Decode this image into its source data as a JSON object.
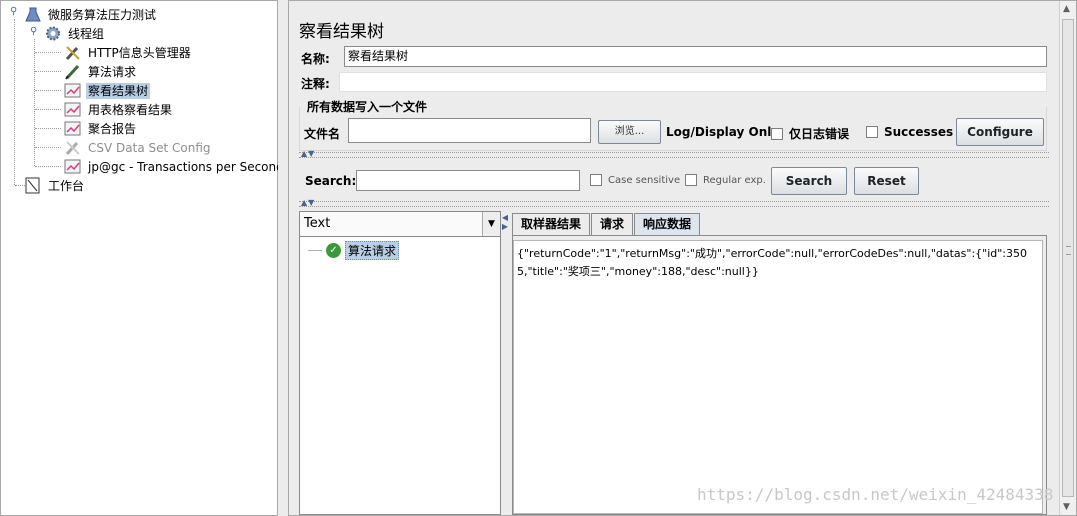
{
  "tree": {
    "items": [
      {
        "label": "微服务算法压力测试",
        "icon": "test-plan-icon"
      },
      {
        "label": "线程组",
        "icon": "thread-group-gear-icon"
      },
      {
        "label": "HTTP信息头管理器",
        "icon": "wrench-icon"
      },
      {
        "label": "算法请求",
        "icon": "http-sampler-pen-icon"
      },
      {
        "label": "察看结果树",
        "icon": "listener-chart-icon",
        "selected": true
      },
      {
        "label": "用表格察看结果",
        "icon": "listener-chart-icon"
      },
      {
        "label": "聚合报告",
        "icon": "listener-chart-icon"
      },
      {
        "label": "CSV Data Set Config",
        "icon": "config-wrench-icon",
        "disabled": true
      },
      {
        "label": "jp@gc - Transactions per Second",
        "icon": "listener-chart-icon"
      },
      {
        "label": "工作台",
        "icon": "workbench-icon"
      }
    ]
  },
  "panel": {
    "title": "察看结果树",
    "name_label": "名称:",
    "name_value": "察看结果树",
    "comment_label": "注释:",
    "comment_value": "",
    "file_group_title": "所有数据写入一个文件",
    "filename_label": "文件名",
    "filename_value": "",
    "browse_button": "浏览...",
    "log_display_label": "Log/Display Only:",
    "errors_only_label": "仅日志错误",
    "successes_label": "Successes",
    "configure_button": "Configure"
  },
  "search": {
    "label": "Search:",
    "value": "",
    "case_sensitive": "Case sensitive",
    "regular_exp": "Regular exp.",
    "search_button": "Search",
    "reset_button": "Reset"
  },
  "results": {
    "renderer": "Text",
    "samples": [
      {
        "label": "算法请求",
        "status": "success"
      }
    ],
    "tabs": [
      "取样器结果",
      "请求",
      "响应数据"
    ],
    "active_tab": "响应数据",
    "response_body": "{\"returnCode\":\"1\",\"returnMsg\":\"成功\",\"errorCode\":null,\"errorCodeDes\":null,\"datas\":{\"id\":3505,\"title\":\"奖项三\",\"money\":188,\"desc\":null}}"
  },
  "watermark": "https://blog.csdn.net/weixin_42484338"
}
